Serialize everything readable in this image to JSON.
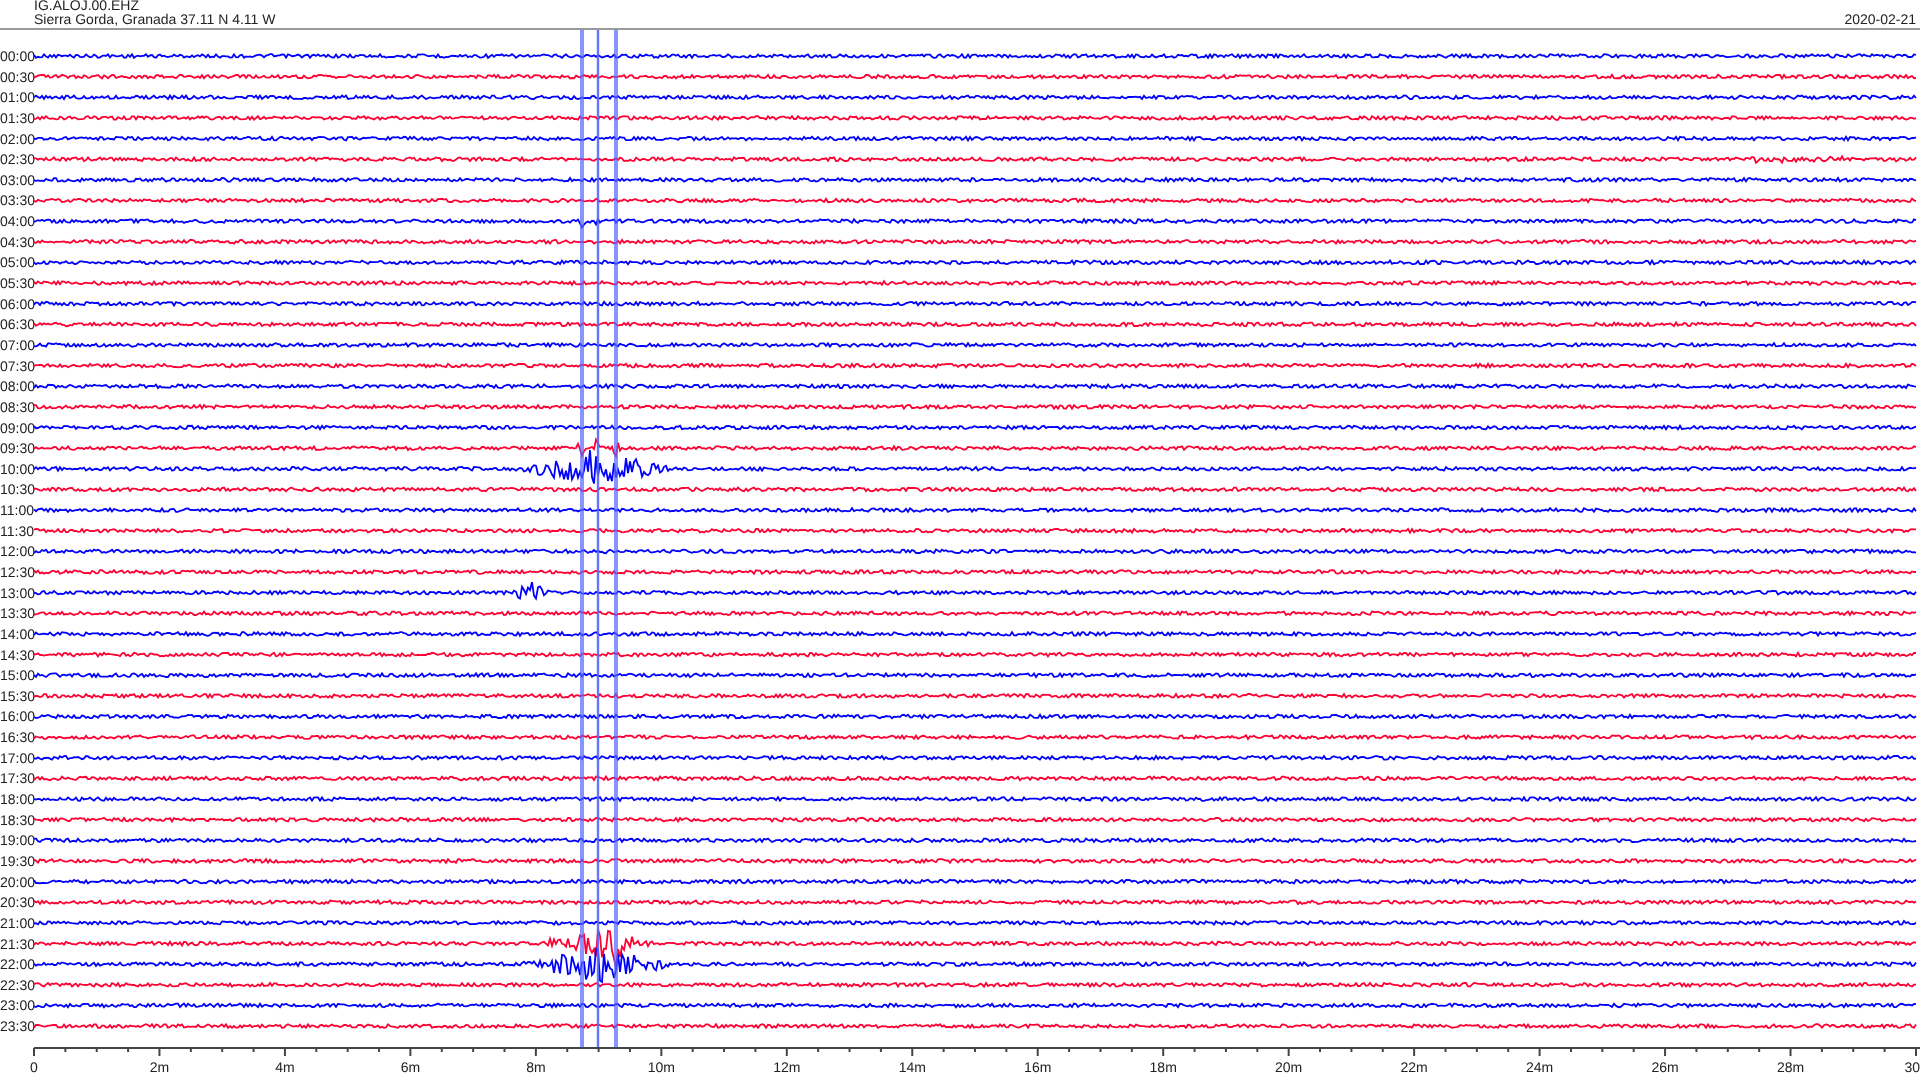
{
  "header": {
    "station": "IG.ALOJ.00.EHZ",
    "location": "Sierra Gorda, Granada  37.11 N 4.11 W",
    "date": "2020-02-21"
  },
  "rows": [
    {
      "label": "00:00",
      "color": "#0000ff"
    },
    {
      "label": "00:30",
      "color": "#ff0033"
    },
    {
      "label": "01:00",
      "color": "#0000ff"
    },
    {
      "label": "01:30",
      "color": "#ff0033"
    },
    {
      "label": "02:00",
      "color": "#0000ff"
    },
    {
      "label": "02:30",
      "color": "#ff0033"
    },
    {
      "label": "03:00",
      "color": "#0000ff"
    },
    {
      "label": "03:30",
      "color": "#ff0033"
    },
    {
      "label": "04:00",
      "color": "#0000ff"
    },
    {
      "label": "04:30",
      "color": "#ff0033"
    },
    {
      "label": "05:00",
      "color": "#0000ff"
    },
    {
      "label": "05:30",
      "color": "#ff0033"
    },
    {
      "label": "06:00",
      "color": "#0000ff"
    },
    {
      "label": "06:30",
      "color": "#ff0033"
    },
    {
      "label": "07:00",
      "color": "#0000ff"
    },
    {
      "label": "07:30",
      "color": "#ff0033"
    },
    {
      "label": "08:00",
      "color": "#0000ff"
    },
    {
      "label": "08:30",
      "color": "#ff0033"
    },
    {
      "label": "09:00",
      "color": "#0000ff"
    },
    {
      "label": "09:30",
      "color": "#ff0033"
    },
    {
      "label": "10:00",
      "color": "#0000ff"
    },
    {
      "label": "10:30",
      "color": "#ff0033"
    },
    {
      "label": "11:00",
      "color": "#0000ff"
    },
    {
      "label": "11:30",
      "color": "#ff0033"
    },
    {
      "label": "12:00",
      "color": "#0000ff"
    },
    {
      "label": "12:30",
      "color": "#ff0033"
    },
    {
      "label": "13:00",
      "color": "#0000ff"
    },
    {
      "label": "13:30",
      "color": "#ff0033"
    },
    {
      "label": "14:00",
      "color": "#0000ff"
    },
    {
      "label": "14:30",
      "color": "#ff0033"
    },
    {
      "label": "15:00",
      "color": "#0000ff"
    },
    {
      "label": "15:30",
      "color": "#ff0033"
    },
    {
      "label": "16:00",
      "color": "#0000ff"
    },
    {
      "label": "16:30",
      "color": "#ff0033"
    },
    {
      "label": "17:00",
      "color": "#0000ff"
    },
    {
      "label": "17:30",
      "color": "#ff0033"
    },
    {
      "label": "18:00",
      "color": "#0000ff"
    },
    {
      "label": "18:30",
      "color": "#ff0033"
    },
    {
      "label": "19:00",
      "color": "#0000ff"
    },
    {
      "label": "19:30",
      "color": "#ff0033"
    },
    {
      "label": "20:00",
      "color": "#0000ff"
    },
    {
      "label": "20:30",
      "color": "#ff0033"
    },
    {
      "label": "21:00",
      "color": "#0000ff"
    },
    {
      "label": "21:30",
      "color": "#ff0033"
    },
    {
      "label": "22:00",
      "color": "#0000ff"
    },
    {
      "label": "22:30",
      "color": "#ff0033"
    },
    {
      "label": "23:00",
      "color": "#0000ff"
    },
    {
      "label": "23:30",
      "color": "#ff0033"
    }
  ],
  "x_axis": {
    "tick_labels": [
      "0",
      "2m",
      "4m",
      "6m",
      "8m",
      "10m",
      "12m",
      "14m",
      "16m",
      "18m",
      "20m",
      "22m",
      "24m",
      "26m",
      "28m",
      "30"
    ]
  }
}
